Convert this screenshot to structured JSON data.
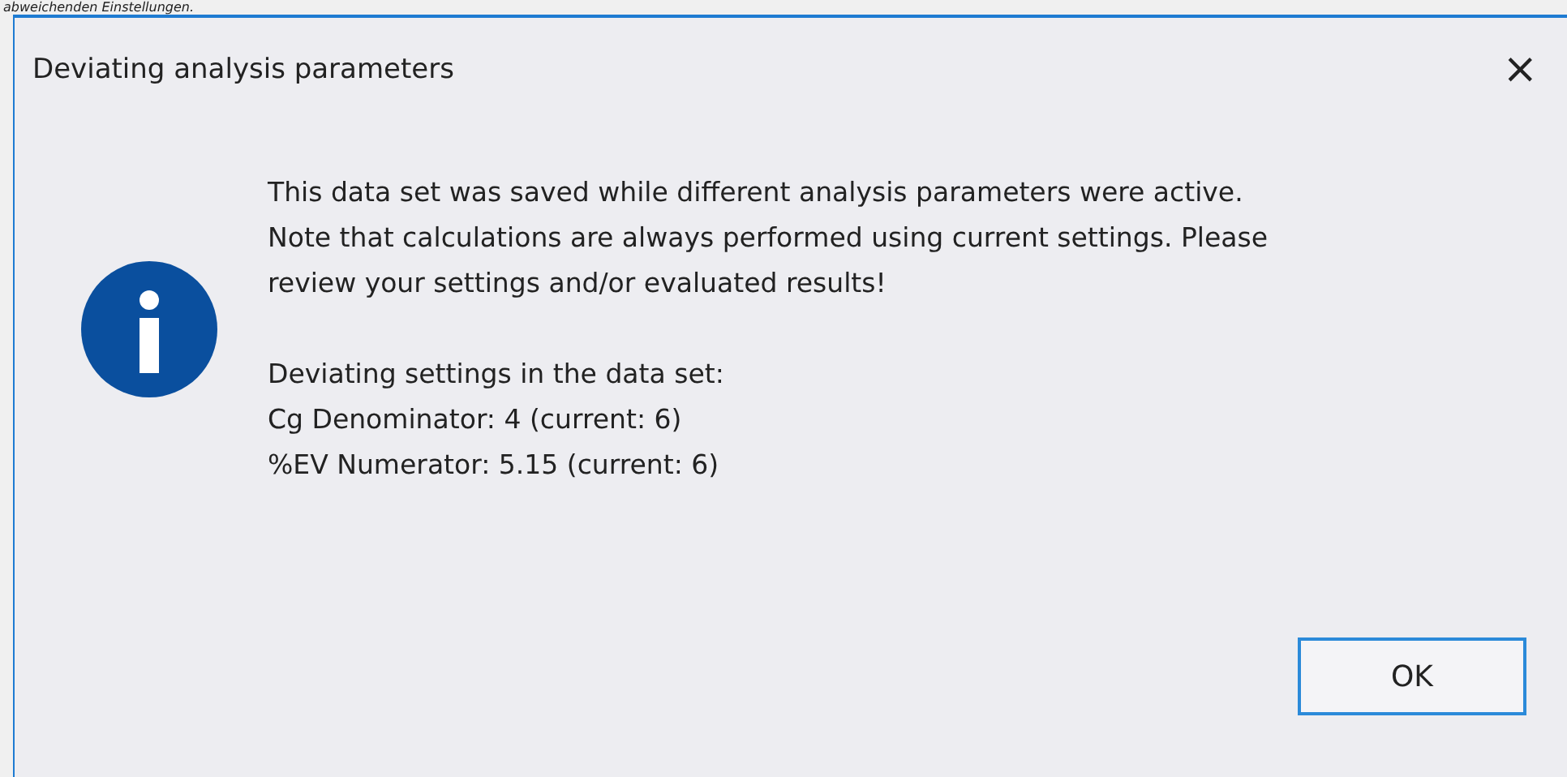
{
  "background_text": "abweichenden Einstellungen.",
  "window": {
    "title": "Deviating analysis parameters",
    "close": "×"
  },
  "message": {
    "paragraphs": [
      [
        "This data set was saved while different analysis parameters were active.",
        "Note that calculations are always performed using current settings. Please",
        "review your settings and/or evaluated results!"
      ],
      [
        "Deviating settings in the data set:",
        "Cg Denominator: 4 (current: 6)",
        "%EV Numerator: 5.15 (current: 6)"
      ]
    ]
  },
  "buttons": [
    {
      "label": "OK",
      "selected": true
    }
  ]
}
